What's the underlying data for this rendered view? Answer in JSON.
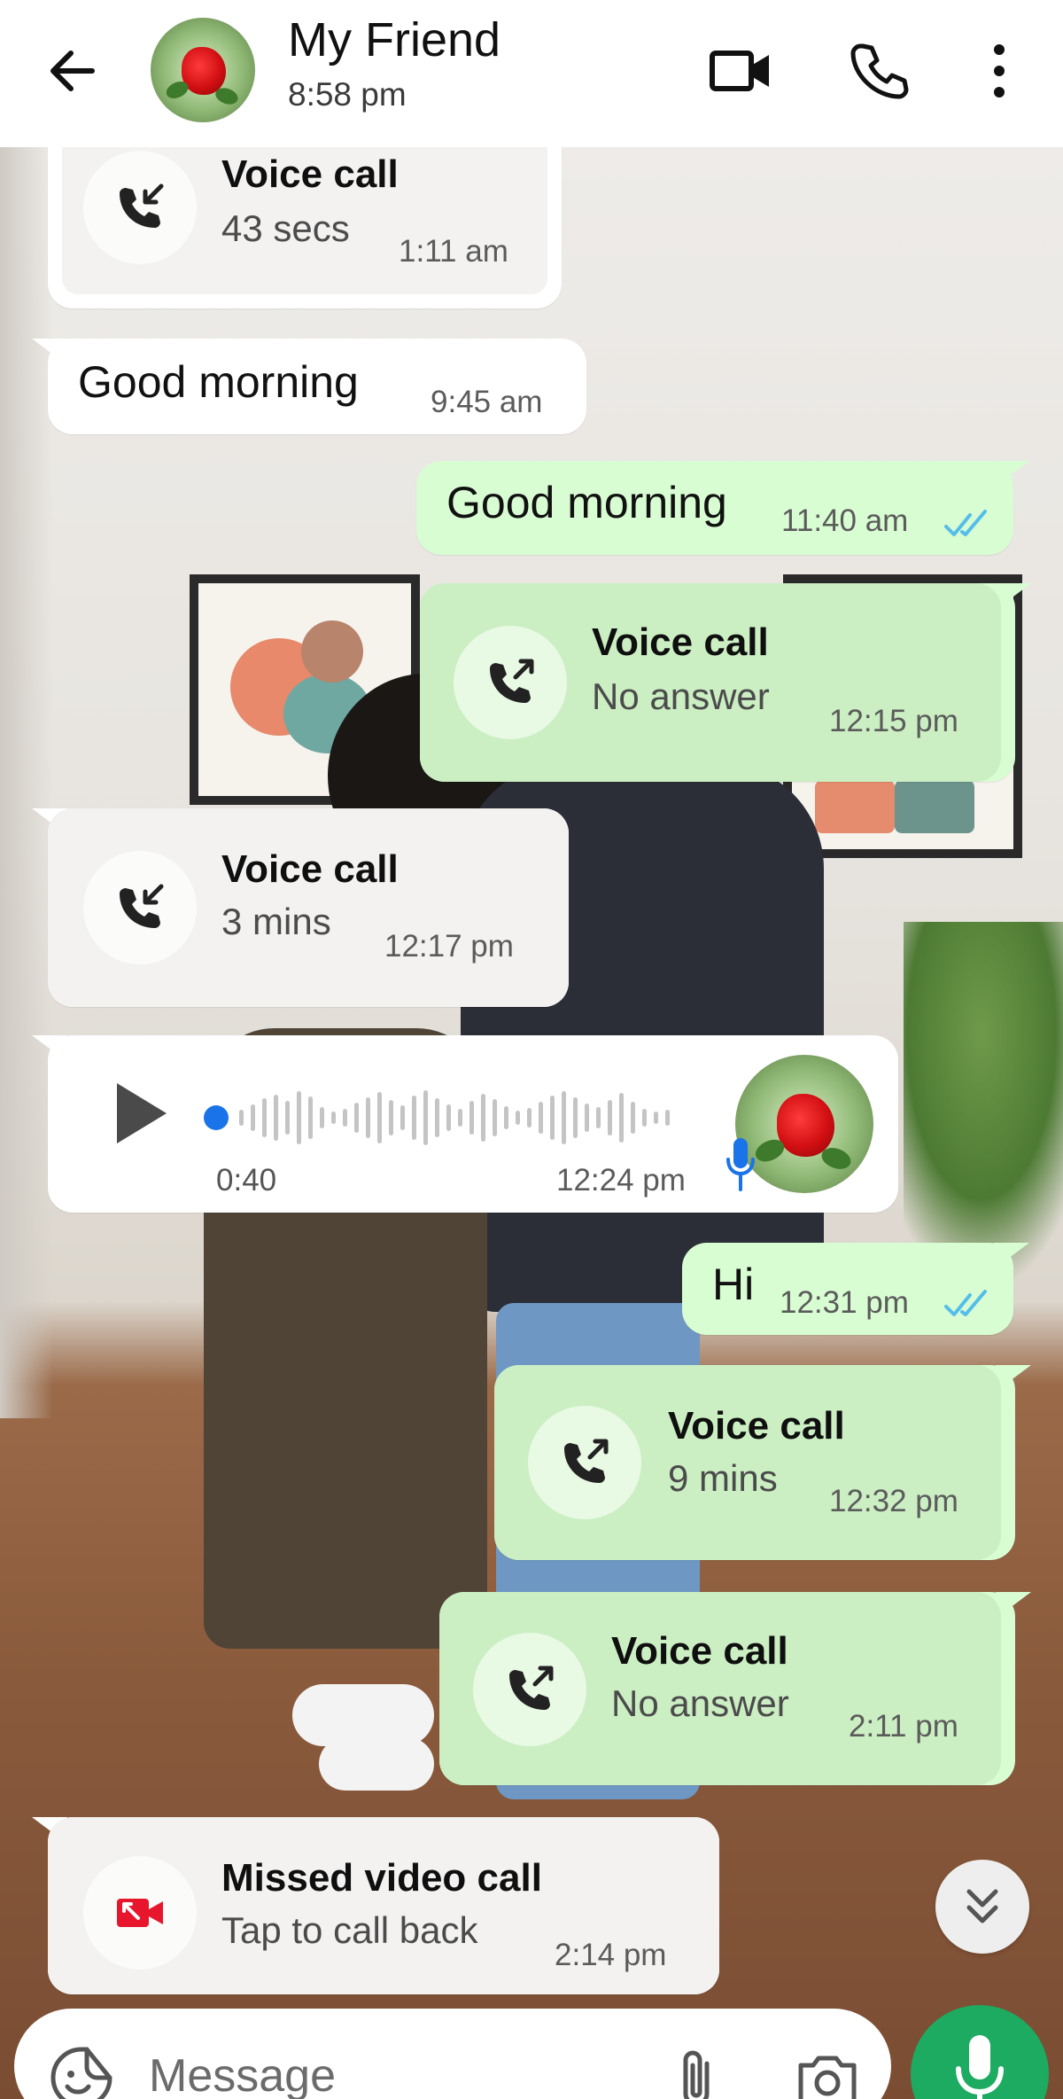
{
  "header": {
    "contact_name": "My Friend",
    "last_seen": "8:58 pm",
    "icons": [
      "back-arrow-icon",
      "video-call-icon",
      "phone-icon",
      "more-vert-icon"
    ]
  },
  "messages": [
    {
      "kind": "call",
      "direction": "incoming",
      "title": "Voice call",
      "detail": "43 secs",
      "time": "1:11 am"
    },
    {
      "kind": "text",
      "direction": "incoming",
      "text": "Good morning",
      "time": "9:45 am"
    },
    {
      "kind": "text",
      "direction": "outgoing",
      "text": "Good morning",
      "time": "11:40 am",
      "status": "read"
    },
    {
      "kind": "call",
      "direction": "outgoing",
      "title": "Voice call",
      "detail": "No answer",
      "time": "12:15 pm"
    },
    {
      "kind": "call",
      "direction": "incoming",
      "title": "Voice call",
      "detail": "3 mins",
      "time": "12:17 pm"
    },
    {
      "kind": "voice-note",
      "direction": "incoming",
      "duration": "0:40",
      "time": "12:24 pm",
      "progress": 0
    },
    {
      "kind": "text",
      "direction": "outgoing",
      "text": "Hi",
      "time": "12:31 pm",
      "status": "read"
    },
    {
      "kind": "call",
      "direction": "outgoing",
      "title": "Voice call",
      "detail": "9 mins",
      "time": "12:32 pm"
    },
    {
      "kind": "call",
      "direction": "outgoing",
      "title": "Voice call",
      "detail": "No answer",
      "time": "2:11 pm"
    },
    {
      "kind": "missed-video",
      "direction": "incoming",
      "title": "Missed video call",
      "detail": "Tap to call back",
      "time": "2:14 pm"
    }
  ],
  "composer": {
    "placeholder": "Message",
    "icons": [
      "sticker-icon",
      "attach-icon",
      "camera-icon",
      "mic-icon"
    ]
  },
  "colors": {
    "outgoing_bubble": "#d9fdd3",
    "incoming_bubble": "#ffffff",
    "accent_green": "#1daa61",
    "read_tick_blue": "#53bdeb",
    "voice_dot_blue": "#1a73e8",
    "missed_red": "#e8162c"
  }
}
